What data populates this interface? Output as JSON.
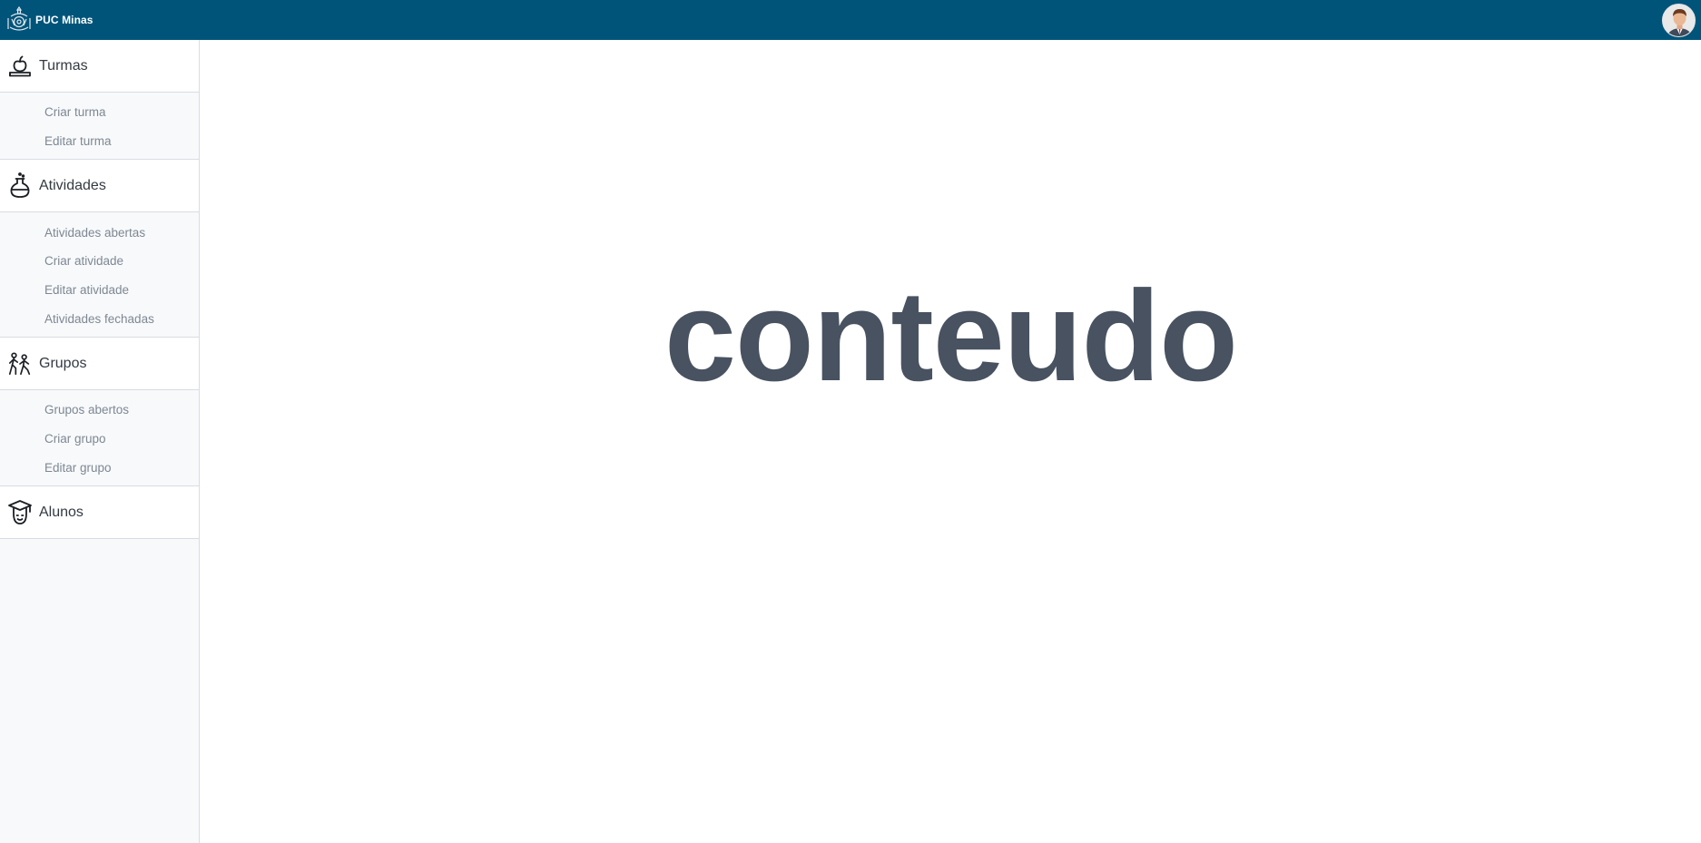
{
  "header": {
    "brand_text": "PUC Minas",
    "brand_icon": "puc-crest-icon",
    "avatar_icon": "user-avatar-icon",
    "bar_color": "#00547a"
  },
  "sidebar": {
    "groups": [
      {
        "label": "Turmas",
        "icon": "apple-on-books-icon",
        "items": [
          "Criar turma",
          "Editar turma"
        ]
      },
      {
        "label": "Atividades",
        "icon": "flask-icon",
        "items": [
          "Atividades abertas",
          "Criar atividade",
          "Editar atividade",
          "Atividades fechadas"
        ]
      },
      {
        "label": "Grupos",
        "icon": "people-walking-icon",
        "items": [
          "Grupos abertos",
          "Criar grupo",
          "Editar grupo"
        ]
      },
      {
        "label": "Alunos",
        "icon": "graduate-student-icon",
        "items": []
      }
    ]
  },
  "main": {
    "content_text": "conteudo"
  }
}
